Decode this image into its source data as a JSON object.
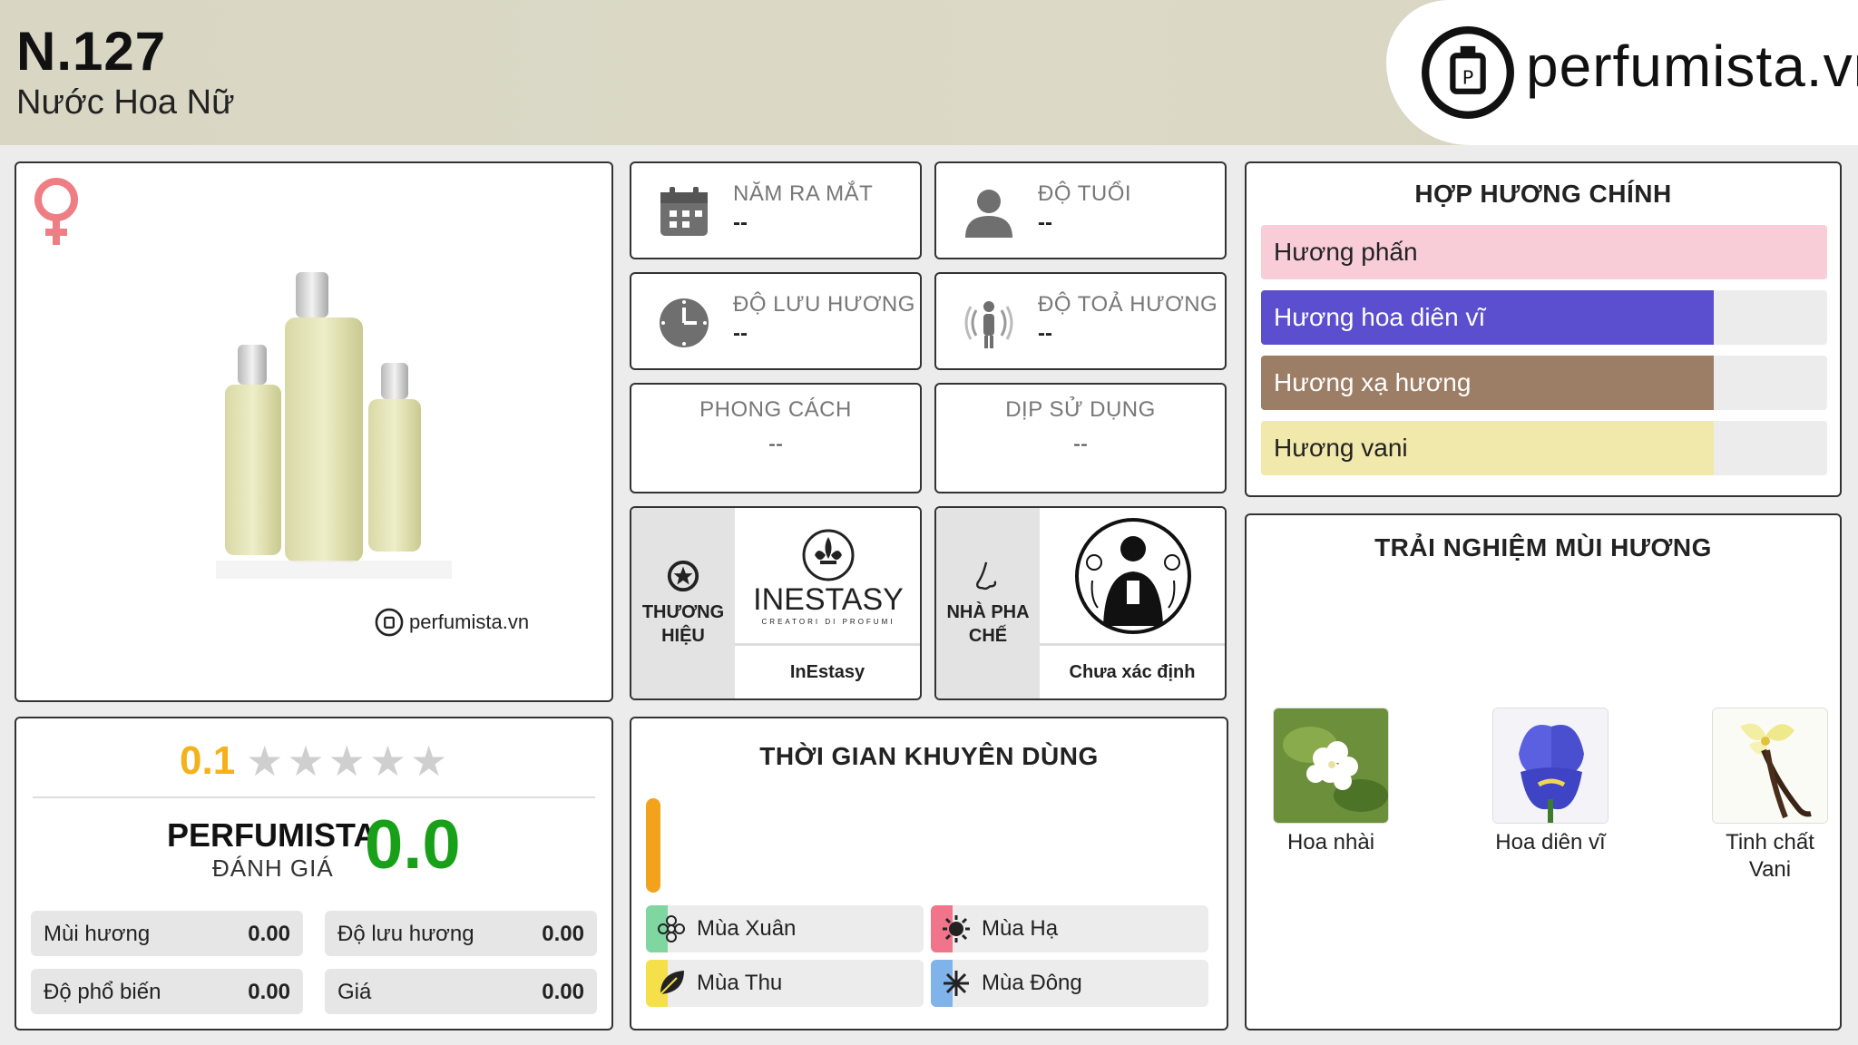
{
  "header": {
    "code": "N.127",
    "subtitle": "Nước Hoa Nữ",
    "logo_text": "perfumista.vn"
  },
  "product": {
    "gender_icon": "female-symbol-icon",
    "watermark": "perfumista.vn"
  },
  "info": {
    "release_year": {
      "label": "NĂM RA MẮT",
      "value": "--",
      "icon": "calendar-icon"
    },
    "age": {
      "label": "ĐỘ TUỔI",
      "value": "--",
      "icon": "person-icon"
    },
    "longevity": {
      "label": "ĐỘ LƯU HƯƠNG",
      "value": "--",
      "icon": "clock-icon"
    },
    "sillage": {
      "label": "ĐỘ TOẢ HƯƠNG",
      "value": "--",
      "icon": "radiating-person-icon"
    },
    "style": {
      "label": "PHONG CÁCH",
      "value": "--"
    },
    "occasion": {
      "label": "DỊP SỬ DỤNG",
      "value": "--"
    }
  },
  "brand": {
    "label": "THƯƠNG HIỆU",
    "logo_text": "INESTASY",
    "logo_sub": "CREATORI DI PROFUMI",
    "name": "InEstasy"
  },
  "perfumer": {
    "label": "NHÀ PHA CHẾ",
    "name": "Chưa xác định"
  },
  "accords": {
    "title": "HỢP HƯƠNG CHÍNH",
    "items": [
      {
        "label": "Hương phấn",
        "pct": 100,
        "color": "#f9cdd8"
      },
      {
        "label": "Hương hoa diên vĩ",
        "pct": 80,
        "color": "#5b4fcf"
      },
      {
        "label": "Hương xạ hương",
        "pct": 80,
        "color": "#9c7e66"
      },
      {
        "label": "Hương vani",
        "pct": 80,
        "color": "#f1e8ac"
      }
    ]
  },
  "notes": {
    "title": "TRẢI NGHIỆM MÙI HƯƠNG",
    "items": [
      {
        "name": "Hoa nhài"
      },
      {
        "name": "Hoa diên vĩ"
      },
      {
        "name": "Tinh chất Vani"
      }
    ]
  },
  "rating": {
    "value": "0.1",
    "stars_filled": 0,
    "stars_total": 5,
    "perfumista_title": "PERFUMISTA",
    "perfumista_sub": "ĐÁNH GIÁ",
    "perfumista_score": "0.0",
    "metrics": [
      {
        "label": "Mùi hương",
        "value": "0.00"
      },
      {
        "label": "Độ lưu hương",
        "value": "0.00"
      },
      {
        "label": "Độ phổ biến",
        "value": "0.00"
      },
      {
        "label": "Giá",
        "value": "0.00"
      }
    ]
  },
  "seasons": {
    "title": "THỜI GIAN KHUYÊN DÙNG",
    "items": [
      {
        "label": "Mùa Xuân",
        "color": "#7fd6a0",
        "icon": "flower-icon"
      },
      {
        "label": "Mùa Hạ",
        "color": "#f0748a",
        "icon": "sun-icon"
      },
      {
        "label": "Mùa Thu",
        "color": "#f6e04a",
        "icon": "leaf-icon"
      },
      {
        "label": "Mùa Đông",
        "color": "#7fb3ea",
        "icon": "snowflake-icon"
      }
    ]
  }
}
